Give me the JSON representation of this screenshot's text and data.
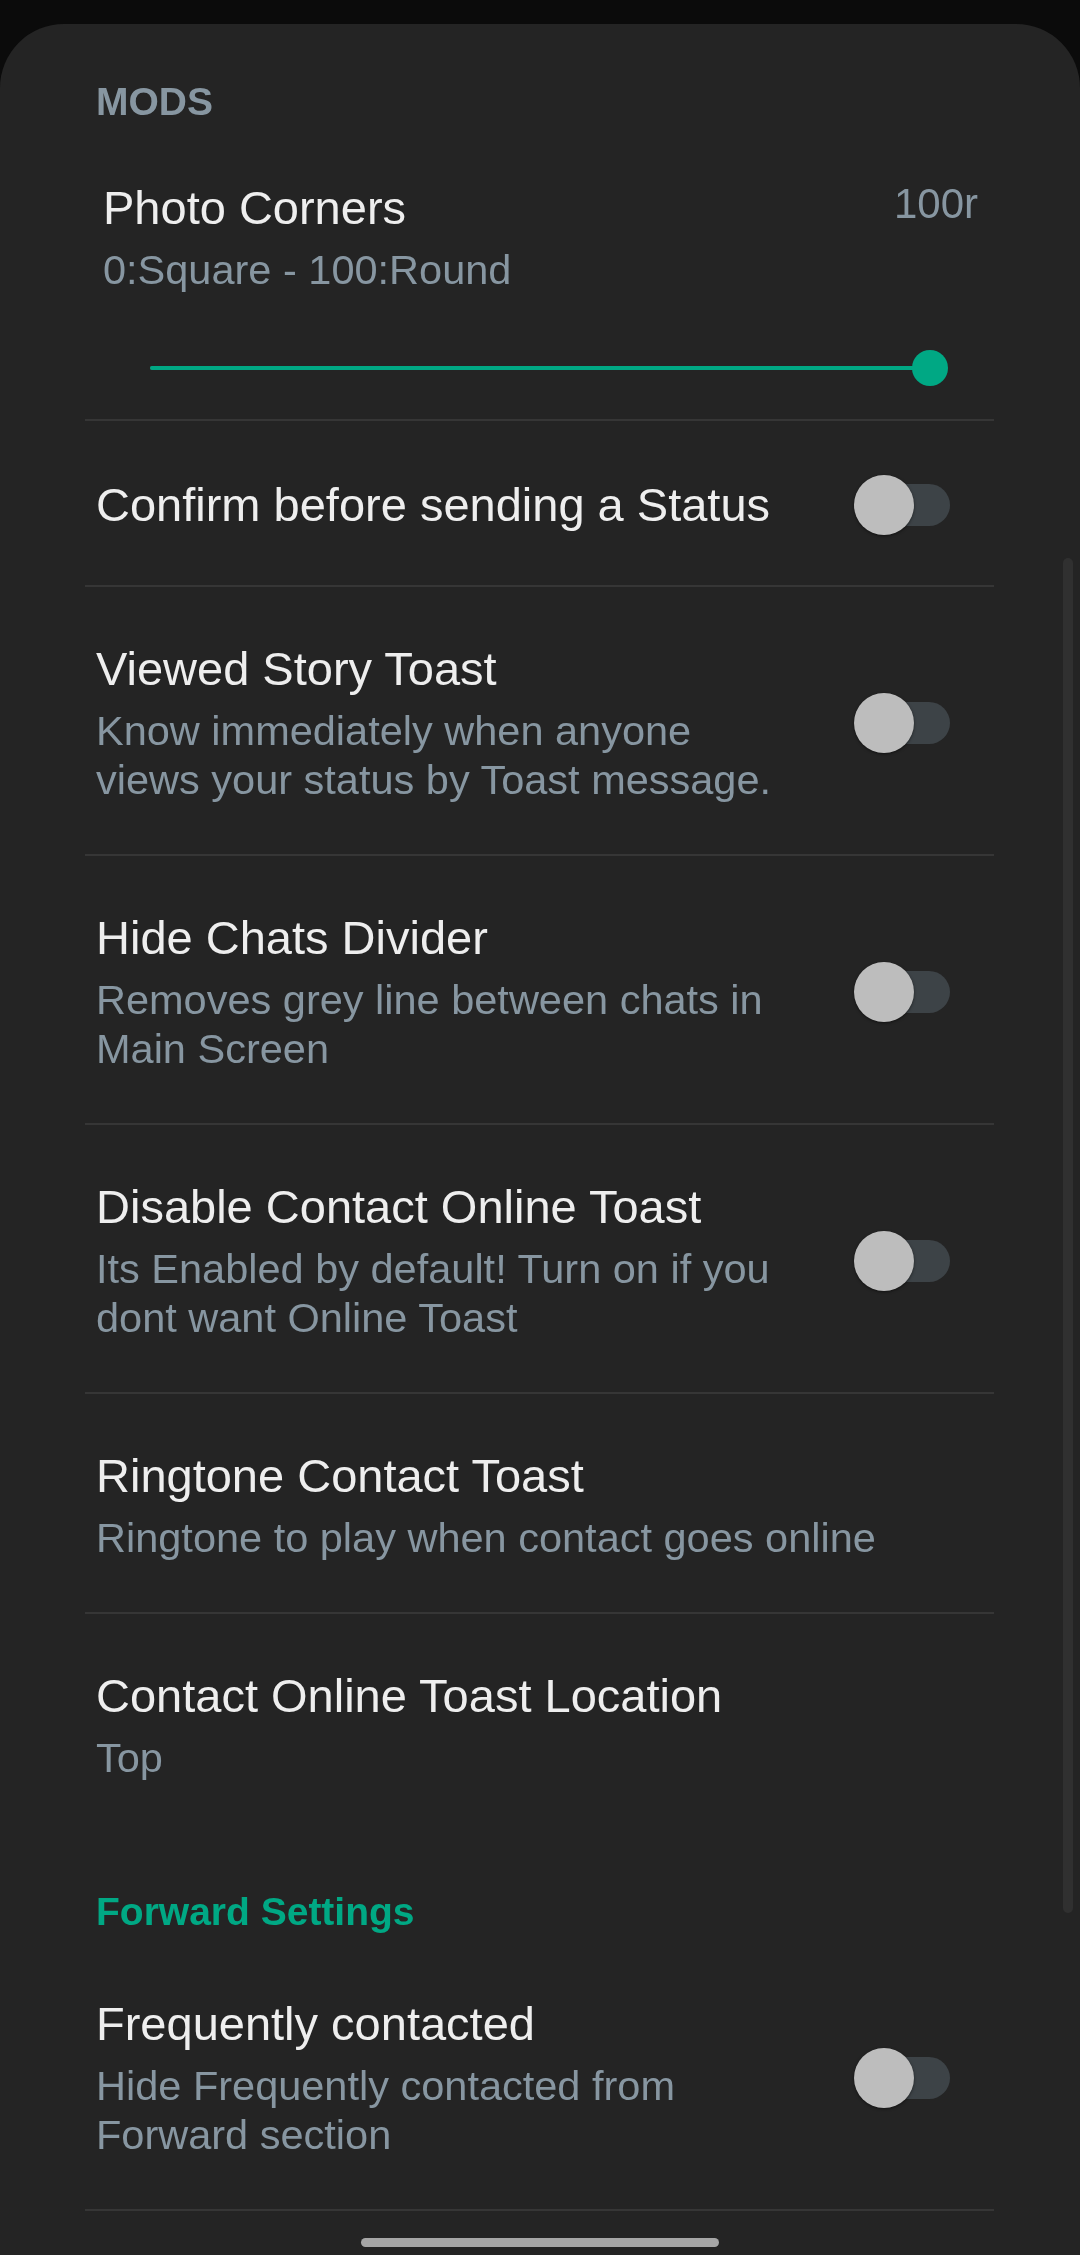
{
  "sections": [
    {
      "kind": "main",
      "title": "MODS",
      "items": [
        {
          "kind": "slider",
          "title": "Photo Corners",
          "value": "100r",
          "summary": "0:Square - 100:Round",
          "level": 1
        },
        {
          "kind": "switch",
          "title": "Confirm before sending a Status",
          "on": false
        },
        {
          "kind": "switch",
          "title": "Viewed Story Toast",
          "summary": "Know immediately when anyone views your status by Toast message.",
          "on": false
        },
        {
          "kind": "switch",
          "title": "Hide Chats Divider",
          "summary": "Removes grey line between chats in Main Screen",
          "on": false
        },
        {
          "kind": "switch",
          "title": "Disable Contact Online Toast",
          "summary": "Its Enabled by default! Turn on if you dont want Online Toast",
          "on": false
        },
        {
          "kind": "text",
          "title": "Ringtone Contact Toast",
          "summary": "Ringtone to play when contact goes online"
        },
        {
          "kind": "text",
          "title": "Contact Online Toast Location",
          "summary": "Top"
        }
      ]
    },
    {
      "kind": "category",
      "title": "Forward Settings",
      "items": [
        {
          "kind": "switch",
          "title": "Frequently contacted",
          "summary": "Hide Frequently contacted from Forward section",
          "on": false
        }
      ]
    }
  ]
}
